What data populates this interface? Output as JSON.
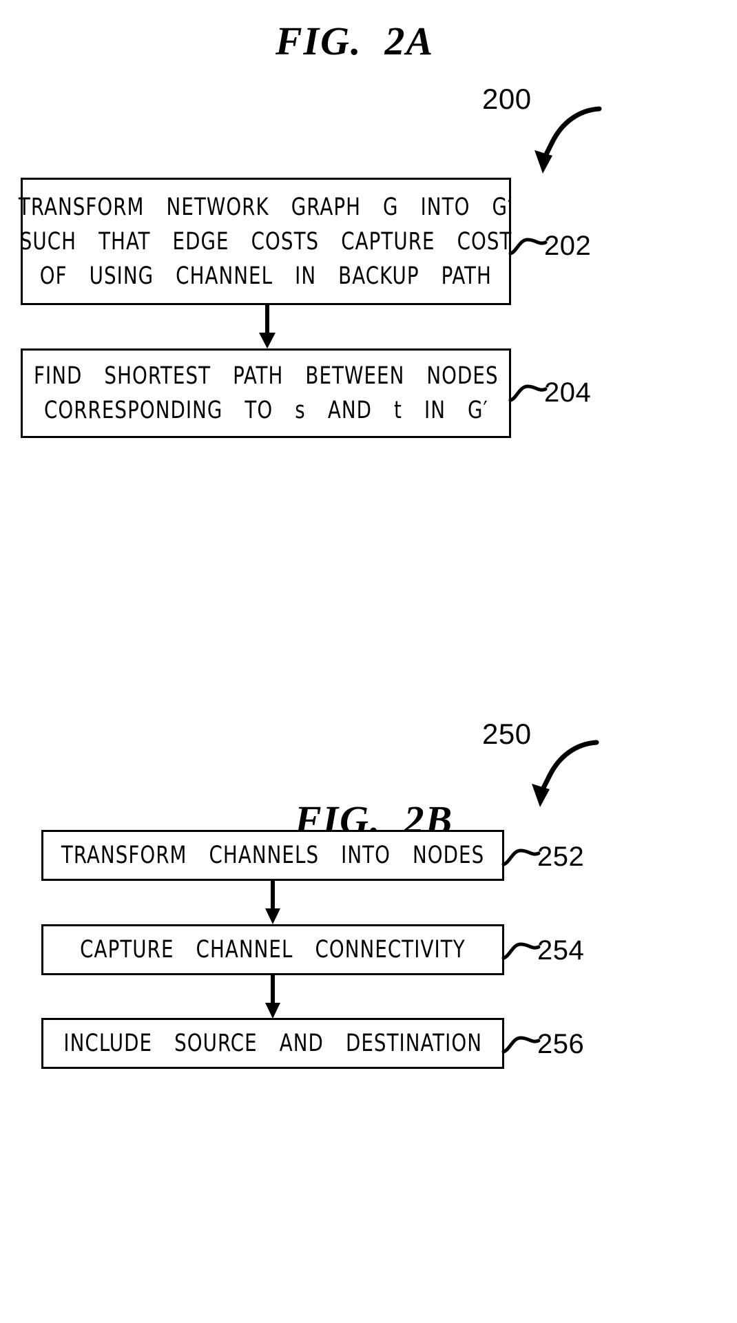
{
  "figures": [
    {
      "id": "fig-2a",
      "title": "FIG.  2A",
      "diagram_ref": "200",
      "steps": [
        {
          "ref": "202",
          "lines": [
            "TRANSFORM  NETWORK  GRAPH  G  INTO  G′",
            "SUCH  THAT  EDGE  COSTS  CAPTURE  COST",
            "OF  USING  CHANNEL  IN  BACKUP  PATH"
          ]
        },
        {
          "ref": "204",
          "lines": [
            "FIND  SHORTEST  PATH  BETWEEN  NODES",
            "CORRESPONDING  TO  s  AND  t  IN  G′"
          ]
        }
      ]
    },
    {
      "id": "fig-2b",
      "title": "FIG.  2B",
      "diagram_ref": "250",
      "steps": [
        {
          "ref": "252",
          "lines": [
            "TRANSFORM  CHANNELS  INTO  NODES"
          ]
        },
        {
          "ref": "254",
          "lines": [
            "CAPTURE  CHANNEL  CONNECTIVITY"
          ]
        },
        {
          "ref": "256",
          "lines": [
            "INCLUDE  SOURCE  AND  DESTINATION"
          ]
        }
      ]
    }
  ],
  "colors": {
    "ink": "#000000",
    "paper": "#ffffff"
  },
  "icons": {
    "down_arrow": "flow-arrow-down-icon",
    "leader_curve": "curved-leader-arrow-icon",
    "squiggle": "squiggle-leader-icon"
  }
}
